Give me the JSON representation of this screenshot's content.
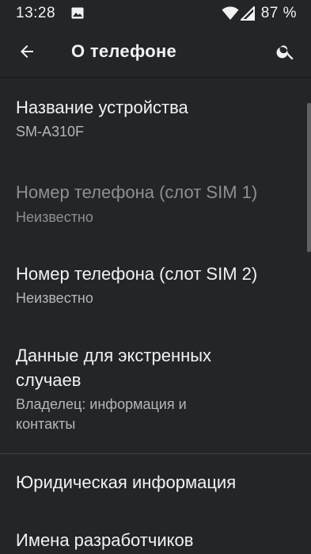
{
  "status_bar": {
    "time": "13:28",
    "battery": "87 %",
    "icons": [
      "image-notification-icon",
      "wifi-icon",
      "signal-icon"
    ]
  },
  "app_bar": {
    "title": "О телефоне",
    "back_icon": "back-arrow-icon",
    "search_icon": "search-icon"
  },
  "items": [
    {
      "title": "Название устройства",
      "subtitle": "SM-A310F",
      "enabled": true
    },
    {
      "title": "Номер телефона (слот SIM 1)",
      "subtitle": "Неизвестно",
      "enabled": false
    },
    {
      "title": "Номер телефона (слот SIM 2)",
      "subtitle": "Неизвестно",
      "enabled": true
    },
    {
      "title": "Данные для экстренных случаев",
      "subtitle": "Владелец: информация и контакты",
      "enabled": true
    },
    {
      "title": "Юридическая информация",
      "enabled": true
    },
    {
      "title": "Имена разработчиков",
      "enabled": true
    }
  ],
  "colors": {
    "background": "#232628",
    "text_primary": "#f2f2f2",
    "text_secondary": "#b4b7b8",
    "text_disabled": "#8d9092"
  }
}
